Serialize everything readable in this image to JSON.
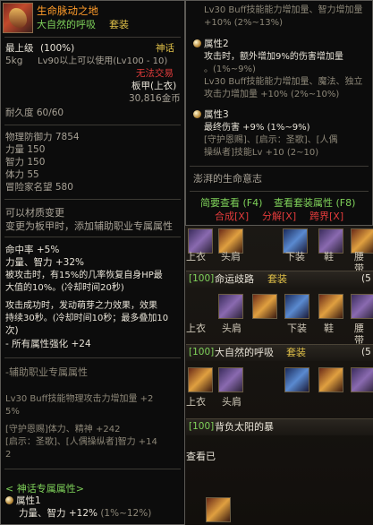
{
  "left_tooltip": {
    "item_name": "生命脉动之地",
    "set_name": "大自然的呼吸",
    "set_tag": "套装",
    "grade_label": "最上级",
    "grade_pct": "(100%)",
    "rarity": "神话",
    "weight": "5kg",
    "level_req": "Lv90以上可以使用(Lv100 - 10)",
    "untradeable": "无法交易",
    "armor_type": "板甲(上衣)",
    "price": "30,816金币",
    "durability": "耐久度 60/60",
    "stats": [
      "物理防御力 7854",
      "力量 150",
      "智力 150",
      "体力 55",
      "冒险家名望 580"
    ],
    "material_change": "可以材质变更",
    "change_to": "变更为板甲时，添加辅助职业专属属性",
    "effects": [
      "命中率 +5%",
      "力量、智力 +32%",
      "被攻击时，有15%的几率恢复自身HP最",
      "大值的10%。(冷却时间20秒)",
      "攻击成功时，发动萌芽之力效果，效果",
      "持续30秒。(冷却时间10秒；最多叠加10",
      "次)",
      "- 所有属性强化 +24"
    ],
    "aux_title": "-辅助职业专属属性",
    "aux_lines": [
      "Lv30 Buff技能物理攻击力增加量 +2",
      "5%",
      "[守护恩赐]体力、精神 +242",
      "[启示：圣歌]、[人偶操纵者]智力 +14",
      "2"
    ],
    "myth_title": "< 神话专属属性>",
    "myth_attr_name": "属性1",
    "myth_attr_line_a": "力量、智力",
    "myth_attr_line_b": "+12%",
    "myth_attr_line_c": "(1%~12%)"
  },
  "right_tooltip": {
    "top_line_1": "Lv30 Buff技能能力增加量、智力增加量",
    "top_line_2": "+10% (2%~13%)",
    "attr2_name": "属性2",
    "attr2_lines": [
      "攻击时，额外增加9%的伤害增加量",
      "。(1%~9%)",
      "Lv30 Buff技能能力增加量、魔法、独立",
      "攻击力增加量 +10% (2%~10%)"
    ],
    "attr3_name": "属性3",
    "attr3_line_a": "最终伤害 +9% (1%~9%)",
    "attr3_lines": [
      "[守护恩赐]、[启示：圣歌]、[人偶",
      "操纵者]技能Lv +10 (2~10)"
    ],
    "set_will": "澎湃的生命意志",
    "brief_view": "简要查看 (F4)",
    "set_attr_view": "查看套装属性 (F8)",
    "synthesize": "合成[X]",
    "decompose": "分解[X]",
    "cross": "跨界[X]"
  },
  "equipment_panel": {
    "row1_labels": [
      "上衣",
      "头肩",
      "下装",
      "鞋",
      "腰带"
    ],
    "set1_level": "[100]",
    "set1_name": "命运歧路",
    "set1_tag": "套装",
    "set1_count": "(5",
    "row2_labels": [
      "上衣",
      "头肩",
      "下装",
      "鞋",
      "腰带"
    ],
    "set2_level": "[100]",
    "set2_name": "大自然的呼吸",
    "set2_tag": "套装",
    "set2_count": "(5",
    "row3_labels": [
      "上衣",
      "头肩"
    ],
    "set3_level": "[100]",
    "set3_name": "背负太阳的暴",
    "bottom_text": "查看已"
  }
}
